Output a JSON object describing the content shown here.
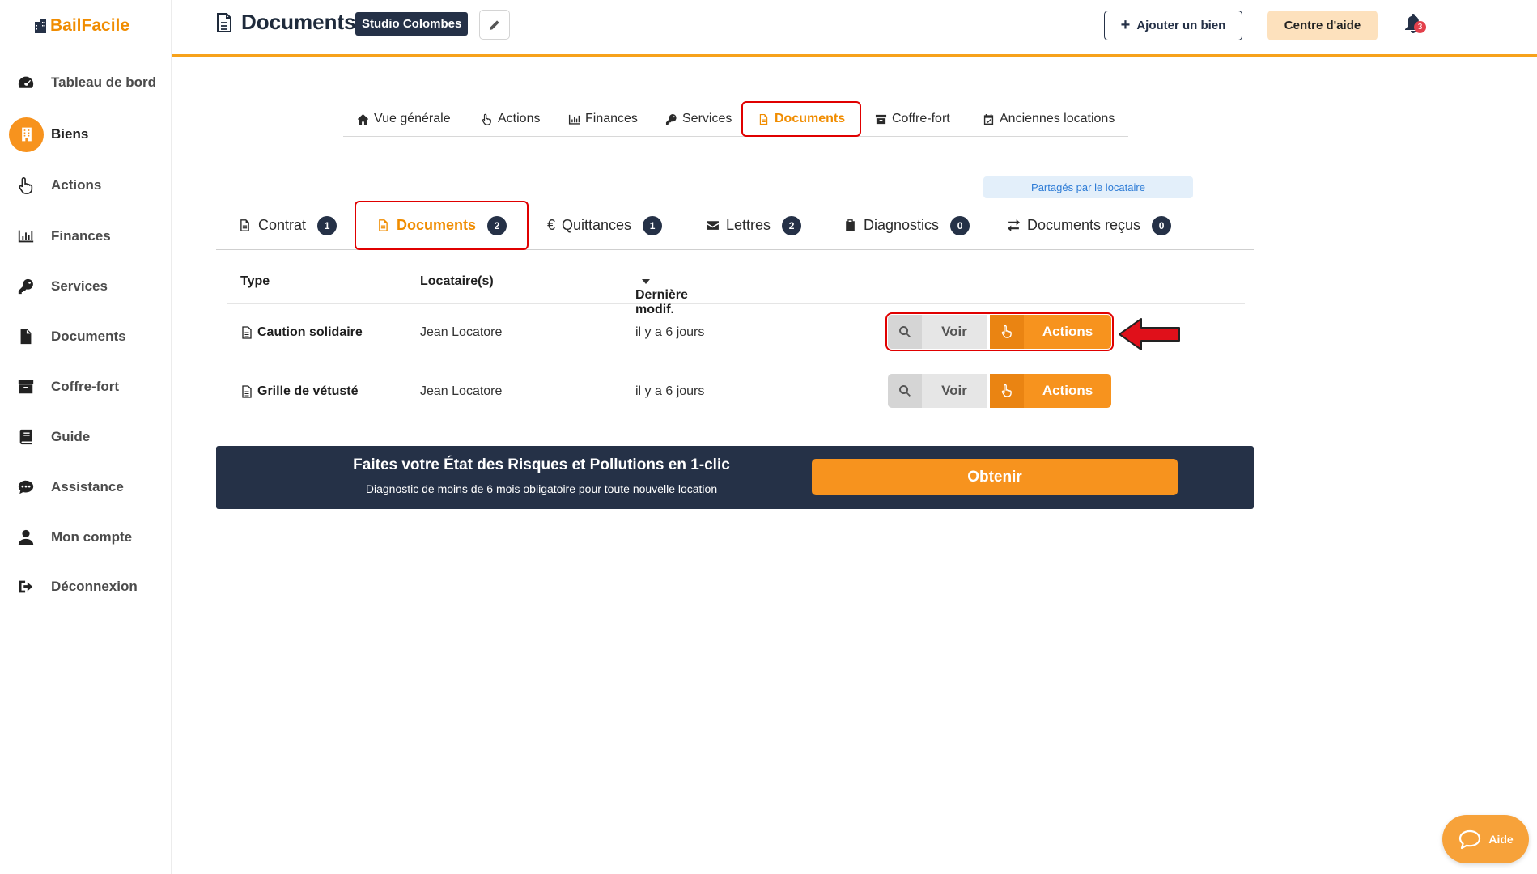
{
  "app": {
    "logo_text": "BailFacile"
  },
  "sidebar": {
    "items": [
      {
        "label": "Tableau de bord",
        "icon": "dashboard-icon"
      },
      {
        "label": "Biens",
        "icon": "building-icon",
        "active": true
      },
      {
        "label": "Actions",
        "icon": "pointer-hand-icon"
      },
      {
        "label": "Finances",
        "icon": "chart-icon"
      },
      {
        "label": "Services",
        "icon": "key-icon"
      },
      {
        "label": "Documents",
        "icon": "document-icon"
      },
      {
        "label": "Coffre-fort",
        "icon": "archive-icon"
      },
      {
        "label": "Guide",
        "icon": "book-icon"
      },
      {
        "label": "Assistance",
        "icon": "chat-icon"
      },
      {
        "label": "Mon compte",
        "icon": "user-icon"
      },
      {
        "label": "Déconnexion",
        "icon": "logout-icon"
      }
    ]
  },
  "header": {
    "title": "Documents",
    "property_badge": "Studio Colombes",
    "add_button": "Ajouter un bien",
    "help_button": "Centre d'aide",
    "notification_count": "3"
  },
  "main_tabs": [
    {
      "label": "Vue générale",
      "icon": "home-icon"
    },
    {
      "label": "Actions",
      "icon": "pointer-hand-icon"
    },
    {
      "label": "Finances",
      "icon": "chart-icon"
    },
    {
      "label": "Services",
      "icon": "key-icon"
    },
    {
      "label": "Documents",
      "icon": "document-icon",
      "active": true
    },
    {
      "label": "Coffre-fort",
      "icon": "archive-icon"
    },
    {
      "label": "Anciennes locations",
      "icon": "calendar-icon"
    }
  ],
  "shared_label": "Partagés par le locataire",
  "sub_tabs": [
    {
      "label": "Contrat",
      "count": "1",
      "icon": "document-icon"
    },
    {
      "label": "Documents",
      "count": "2",
      "icon": "document-icon",
      "active": true
    },
    {
      "label": "Quittances",
      "count": "1",
      "icon": "euro-icon"
    },
    {
      "label": "Lettres",
      "count": "2",
      "icon": "envelope-icon"
    },
    {
      "label": "Diagnostics",
      "count": "0",
      "icon": "clipboard-icon"
    },
    {
      "label": "Documents reçus",
      "count": "0",
      "icon": "exchange-icon"
    }
  ],
  "table": {
    "headers": {
      "type": "Type",
      "tenant": "Locataire(s)",
      "modified": "Dernière modif."
    },
    "rows": [
      {
        "type": "Caution solidaire",
        "tenant": "Jean Locatore",
        "modified": "il y a 6 jours",
        "view": "Voir",
        "actions": "Actions"
      },
      {
        "type": "Grille de vétusté",
        "tenant": "Jean Locatore",
        "modified": "il y a 6 jours",
        "view": "Voir",
        "actions": "Actions"
      }
    ]
  },
  "banner": {
    "title": "Faites votre État des Risques et Pollutions en 1-clic",
    "subtitle": "Diagnostic de moins de 6 mois obligatoire pour toute nouvelle location",
    "button": "Obtenir"
  },
  "help_fab": "Aide",
  "colors": {
    "accent": "#f7931e",
    "navy": "#253147",
    "highlight": "#e00000"
  }
}
